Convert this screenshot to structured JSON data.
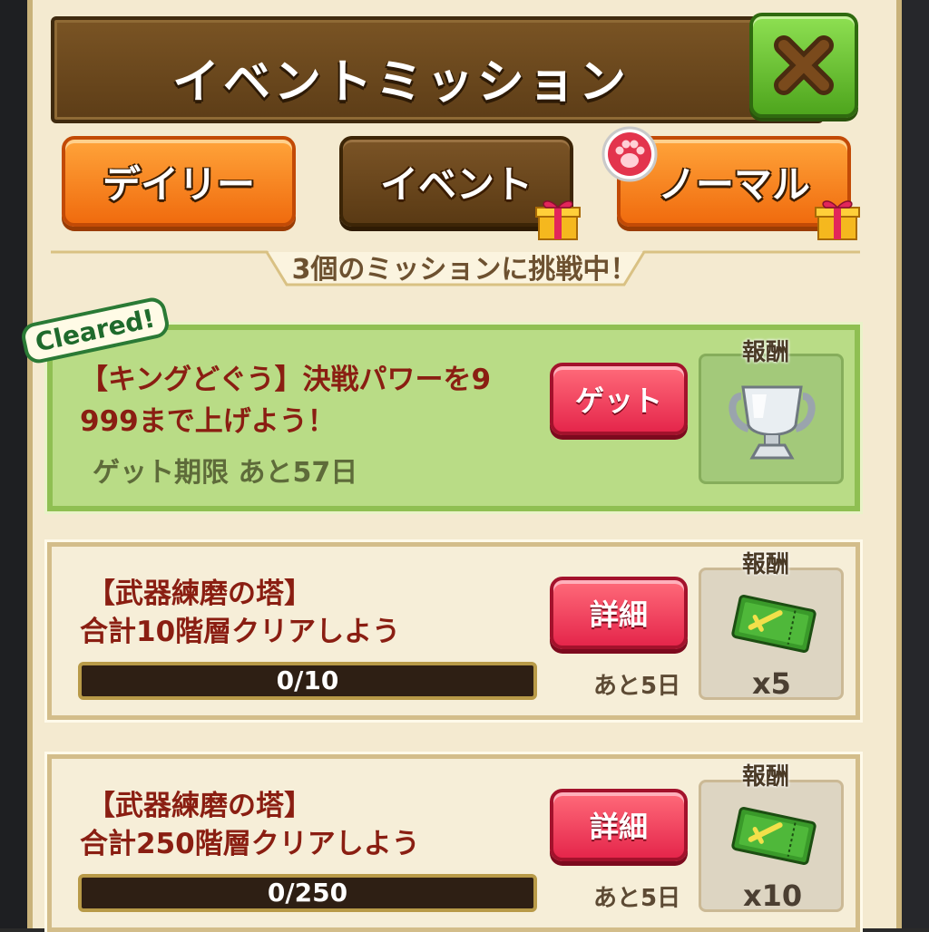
{
  "header": {
    "title": "イベントミッション"
  },
  "tabs": [
    {
      "label": "デイリー",
      "state": "inactive"
    },
    {
      "label": "イベント",
      "state": "active"
    },
    {
      "label": "ノーマル",
      "state": "inactive"
    }
  ],
  "subtitle": "3個のミッションに挑戦中！",
  "missions": [
    {
      "status_badge": "Cleared!",
      "title_line1": "【キングどぐう】決戦パワーを9",
      "title_line2": "999まで上げよう！",
      "deadline": "ゲット期限 あと57日",
      "button": "ゲット",
      "reward_label": "報酬",
      "reward_icon": "trophy-icon"
    },
    {
      "title_line1": "【武器練磨の塔】",
      "title_line2": "合計10階層クリアしよう",
      "progress_text": "0/10",
      "progress_value": 0,
      "remaining": "あと5日",
      "button": "詳細",
      "reward_label": "報酬",
      "reward_icon": "ticket-icon",
      "reward_count": "x5"
    },
    {
      "title_line1": "【武器練磨の塔】",
      "title_line2": "合計250階層クリアしよう",
      "progress_text": "0/250",
      "progress_value": 0,
      "remaining": "あと5日",
      "button": "詳細",
      "reward_label": "報酬",
      "reward_icon": "ticket-icon",
      "reward_count": "x10"
    }
  ],
  "colors": {
    "header_bg": "#6b481c",
    "tab_orange": "#f57f1c",
    "tab_active": "#6a4720",
    "cleared_bg": "#b9dc86",
    "button_red": "#ec3656",
    "close_green": "#5fbd2a"
  }
}
